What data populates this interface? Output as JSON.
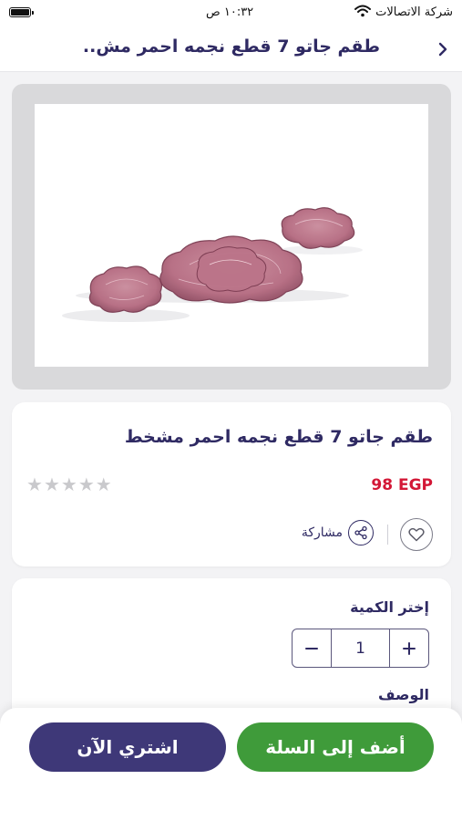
{
  "status_bar": {
    "carrier": "شركة الاتصالات",
    "time": "١٠:٣٢ ص"
  },
  "header": {
    "title": "طقم جاتو 7 قطع نجمه احمر مش.."
  },
  "product": {
    "name": "طقم جاتو 7 قطع نجمه احمر مشخط",
    "price": "98 EGP",
    "rating": 0,
    "rating_max": 5,
    "share_label": "مشاركة"
  },
  "quantity": {
    "label": "إختر الكمية",
    "value": "1"
  },
  "description": {
    "label": "الوصف"
  },
  "actions": {
    "add_to_cart": "أضف إلى السلة",
    "buy_now": "اشتري الآن"
  },
  "colors": {
    "primary": "#2f2a63",
    "price": "#d31736",
    "cart_button": "#3f9b3a",
    "buy_button": "#3e3878"
  },
  "icons": [
    "back-chevron-icon",
    "heart-icon",
    "share-icon",
    "minus-icon",
    "plus-icon",
    "star-icon",
    "wifi-icon",
    "battery-icon"
  ]
}
